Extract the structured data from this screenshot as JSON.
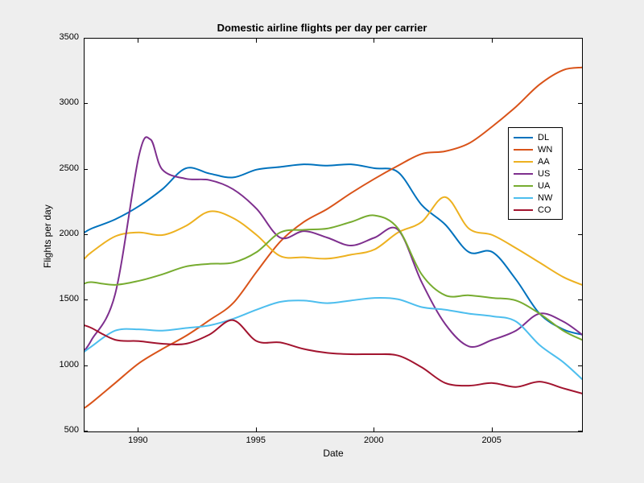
{
  "chart_data": {
    "type": "line",
    "title": "Domestic airline flights per day per carrier",
    "xlabel": "Date",
    "ylabel": "Flights per day",
    "xlim": [
      1987.7,
      2008.8
    ],
    "ylim": [
      500,
      3500
    ],
    "xticks": [
      1990,
      1995,
      2000,
      2005
    ],
    "yticks": [
      500,
      1000,
      1500,
      2000,
      2500,
      3000,
      3500
    ],
    "series": [
      {
        "name": "DL",
        "color": "#0072BD",
        "x": [
          1987.7,
          1988,
          1989,
          1990,
          1991,
          1992,
          1993,
          1994,
          1995,
          1996,
          1997,
          1998,
          1999,
          2000,
          2001,
          2002,
          2003,
          2004,
          2005,
          2006,
          2007,
          2008,
          2008.8
        ],
        "y": [
          2020,
          2050,
          2120,
          2220,
          2350,
          2510,
          2470,
          2440,
          2500,
          2520,
          2540,
          2530,
          2540,
          2510,
          2480,
          2230,
          2080,
          1870,
          1870,
          1660,
          1400,
          1280,
          1240
        ]
      },
      {
        "name": "WN",
        "color": "#D95319",
        "x": [
          1987.7,
          1988,
          1989,
          1990,
          1991,
          1992,
          1993,
          1994,
          1995,
          1996,
          1997,
          1998,
          1999,
          2000,
          2001,
          2002,
          2003,
          2004,
          2005,
          2006,
          2007,
          2008,
          2008.8
        ],
        "y": [
          680,
          720,
          870,
          1020,
          1130,
          1230,
          1350,
          1480,
          1720,
          1950,
          2100,
          2200,
          2320,
          2430,
          2530,
          2620,
          2640,
          2700,
          2830,
          2980,
          3150,
          3260,
          3280
        ]
      },
      {
        "name": "AA",
        "color": "#EDB120",
        "x": [
          1987.7,
          1988,
          1989,
          1990,
          1991,
          1992,
          1993,
          1994,
          1995,
          1996,
          1997,
          1998,
          1999,
          2000,
          2001,
          2002,
          2003,
          2004,
          2005,
          2006,
          2007,
          2008,
          2008.8
        ],
        "y": [
          1820,
          1870,
          1990,
          2020,
          2000,
          2070,
          2180,
          2130,
          2000,
          1840,
          1830,
          1820,
          1850,
          1890,
          2020,
          2100,
          2290,
          2050,
          2000,
          1900,
          1790,
          1680,
          1620
        ]
      },
      {
        "name": "US",
        "color": "#7E2F8E",
        "x": [
          1987.7,
          1988,
          1989,
          1990,
          1990.5,
          1991,
          1992,
          1993,
          1994,
          1995,
          1996,
          1997,
          1998,
          1999,
          2000,
          2001,
          2002,
          2003,
          2004,
          2005,
          2006,
          2007,
          2008,
          2008.8
        ],
        "y": [
          1120,
          1200,
          1550,
          2600,
          2730,
          2500,
          2430,
          2420,
          2350,
          2200,
          1980,
          2030,
          1980,
          1920,
          1980,
          2040,
          1640,
          1320,
          1150,
          1200,
          1270,
          1400,
          1340,
          1240
        ]
      },
      {
        "name": "UA",
        "color": "#77AC30",
        "x": [
          1987.7,
          1988,
          1989,
          1990,
          1991,
          1992,
          1993,
          1994,
          1995,
          1996,
          1997,
          1998,
          1999,
          2000,
          2001,
          2002,
          2003,
          2004,
          2005,
          2006,
          2007,
          2008,
          2008.8
        ],
        "y": [
          1630,
          1640,
          1620,
          1650,
          1700,
          1760,
          1780,
          1790,
          1870,
          2020,
          2040,
          2050,
          2100,
          2150,
          2050,
          1700,
          1540,
          1540,
          1520,
          1500,
          1400,
          1270,
          1200
        ]
      },
      {
        "name": "NW",
        "color": "#4DBEEE",
        "x": [
          1987.7,
          1988,
          1989,
          1990,
          1991,
          1992,
          1993,
          1994,
          1995,
          1996,
          1997,
          1998,
          1999,
          2000,
          2001,
          2002,
          2003,
          2004,
          2005,
          2006,
          2007,
          2008,
          2008.8
        ],
        "y": [
          1110,
          1150,
          1270,
          1280,
          1270,
          1290,
          1310,
          1360,
          1430,
          1490,
          1500,
          1480,
          1500,
          1520,
          1510,
          1450,
          1430,
          1400,
          1380,
          1340,
          1160,
          1030,
          900
        ]
      },
      {
        "name": "CO",
        "color": "#A2142F",
        "x": [
          1987.7,
          1988,
          1989,
          1990,
          1991,
          1992,
          1993,
          1994,
          1995,
          1996,
          1997,
          1998,
          1999,
          2000,
          2001,
          2002,
          2003,
          2004,
          2005,
          2006,
          2007,
          2008,
          2008.8
        ],
        "y": [
          1310,
          1290,
          1200,
          1190,
          1170,
          1170,
          1240,
          1350,
          1190,
          1180,
          1130,
          1100,
          1090,
          1090,
          1080,
          990,
          870,
          850,
          870,
          840,
          880,
          830,
          790
        ]
      }
    ],
    "legend_position": "upper-right-inset"
  }
}
